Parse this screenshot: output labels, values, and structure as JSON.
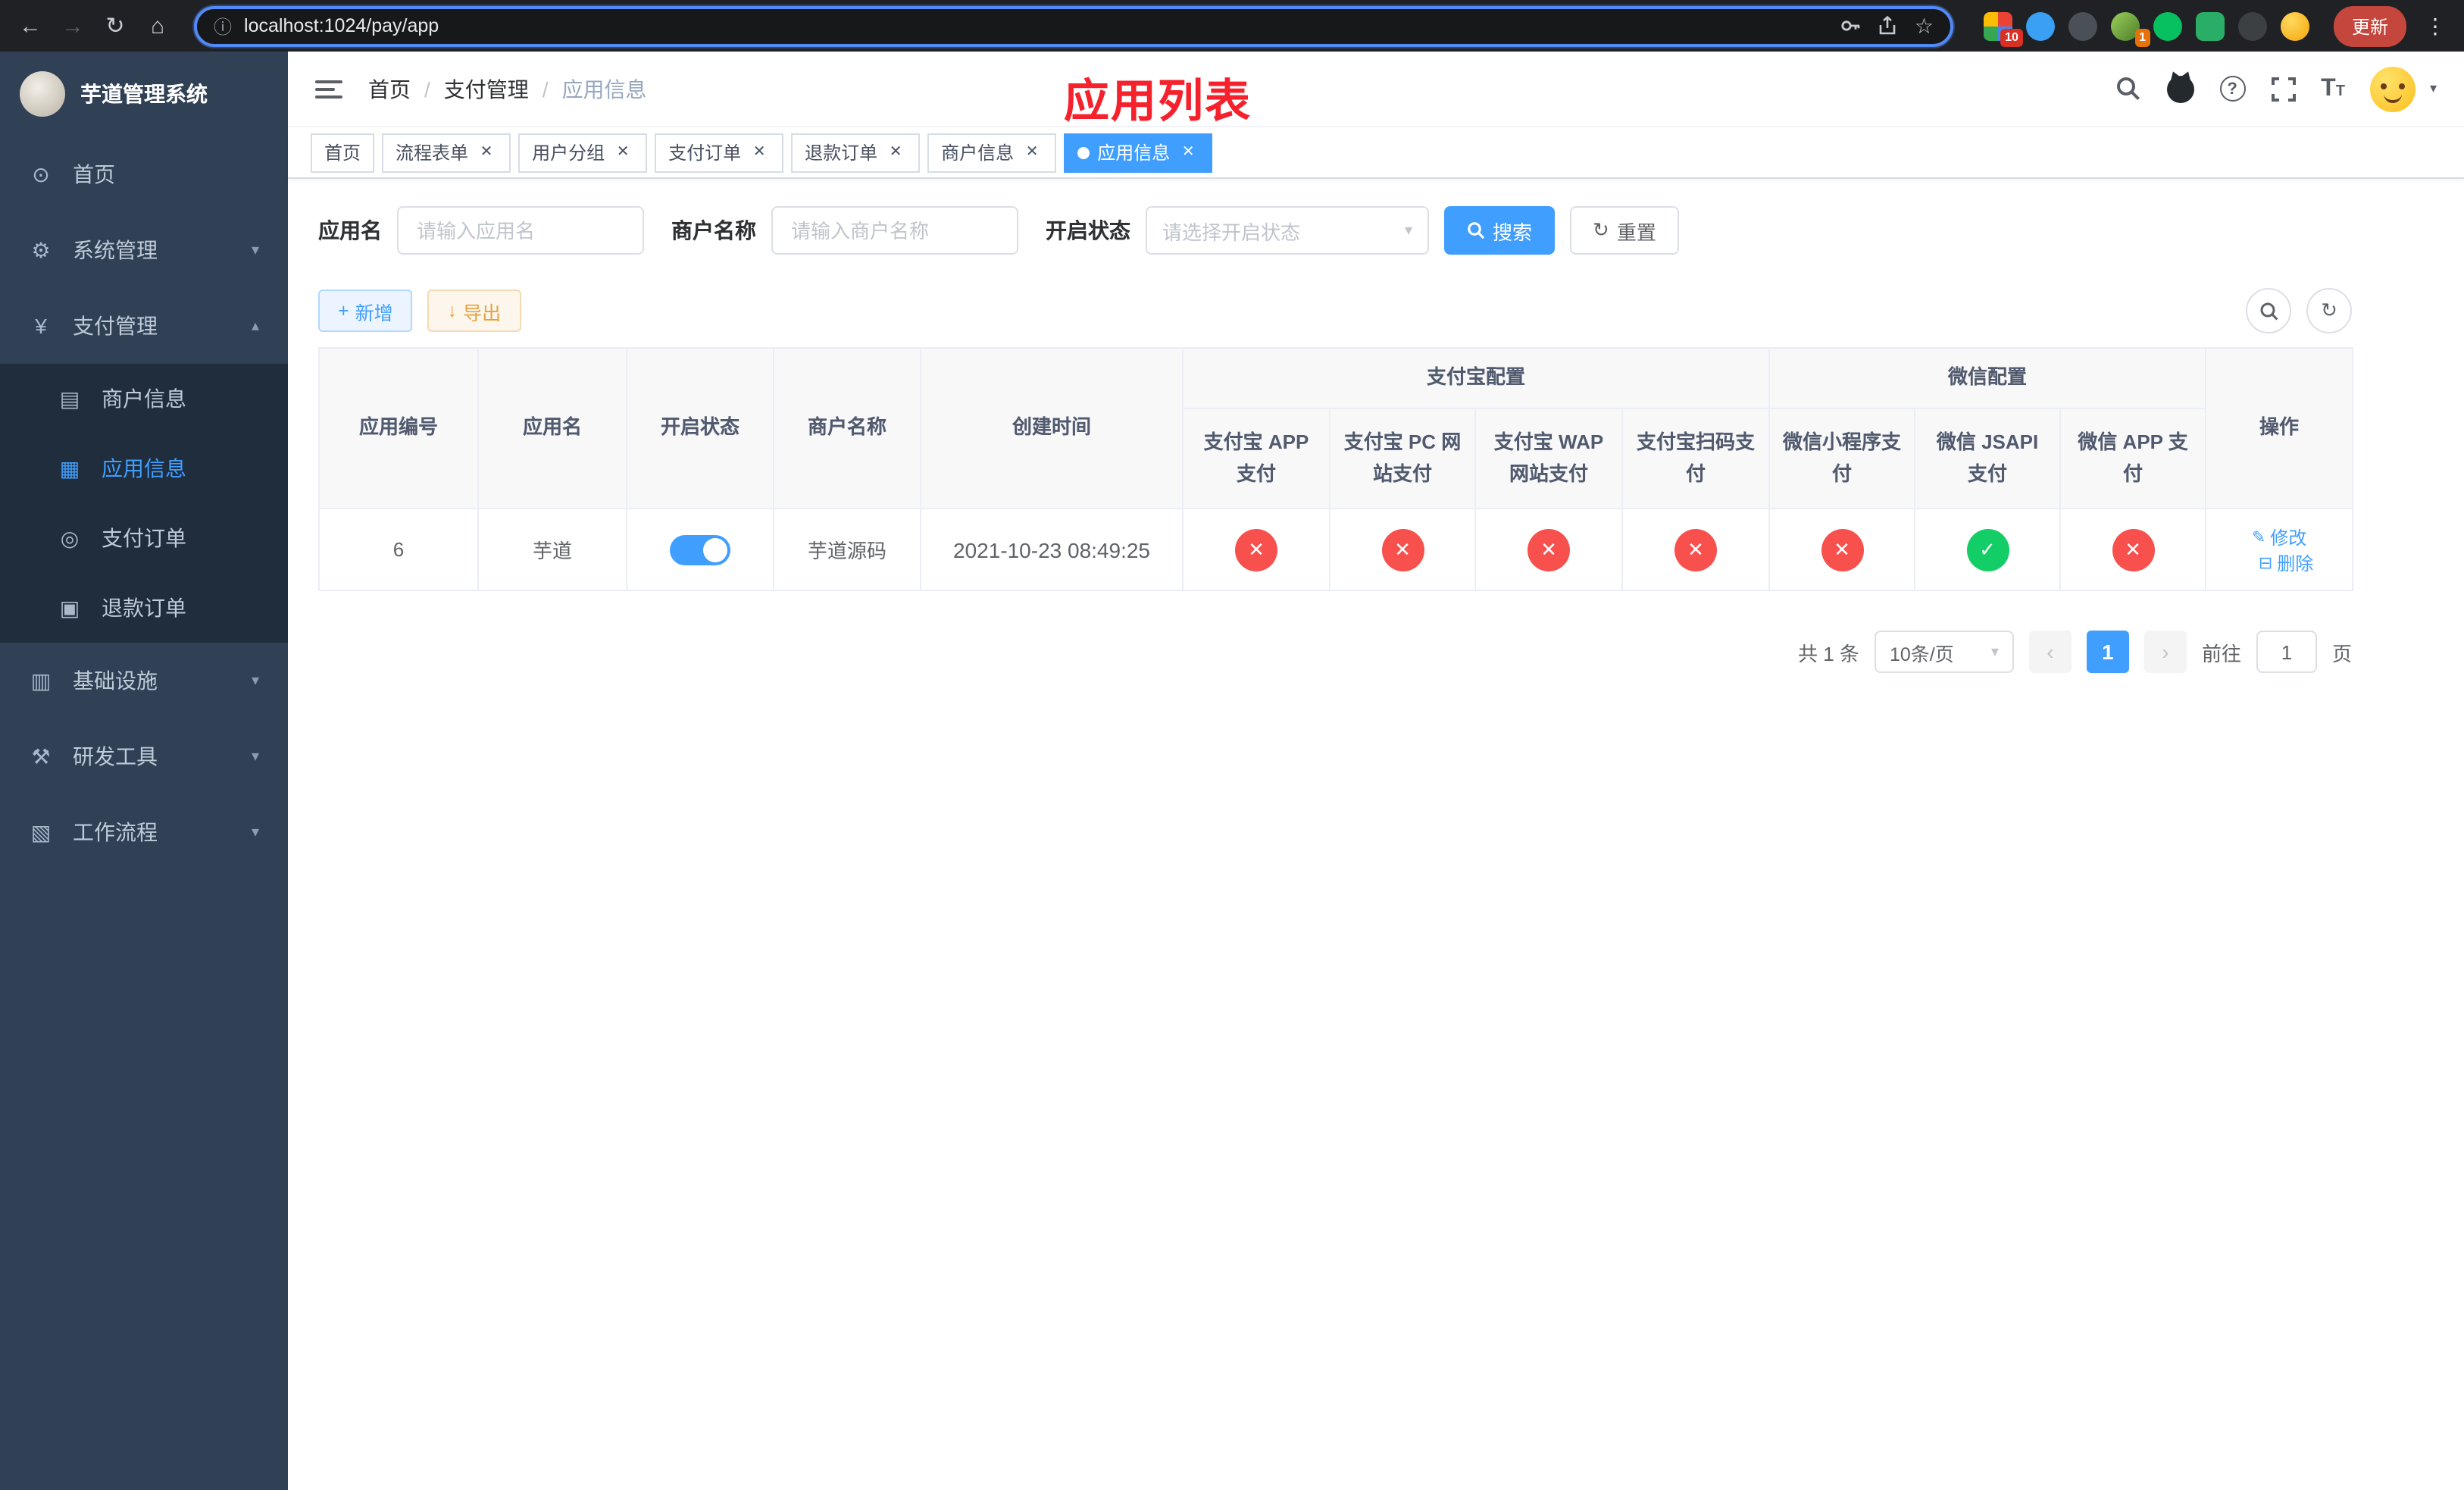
{
  "colors": {
    "accent": "#409eff",
    "danger": "#f7504d",
    "success": "#13ce66",
    "title_red": "#f5222d"
  },
  "icons": {
    "back": "←",
    "forward": "→",
    "reload": "↻",
    "home": "⌂",
    "info": "ⓘ",
    "star": "☆",
    "dots": "⋮",
    "dashboard": "⊙",
    "gear": "⚙",
    "yen": "¥",
    "merchant": "▤",
    "app": "▦",
    "order": "◎",
    "refund": "▣",
    "infra": "▥",
    "tools": "⚒",
    "workflow": "▧",
    "chevron_down": "▾",
    "chevron_up": "▴",
    "caret_down": "▾",
    "close": "✕",
    "check": "✓",
    "cross": "✕",
    "plus": "+",
    "download": "↓",
    "reset": "↻",
    "refresh": "↻",
    "edit": "✎",
    "trash": "⊟",
    "prev": "‹",
    "next": "›",
    "question": "?",
    "size_big": "T",
    "size_small": "T"
  },
  "browser": {
    "url": "localhost:1024/pay/app",
    "update_label": "更新",
    "ext_badge_grid": "10",
    "ext_badge_avatar": "1"
  },
  "sidebar": {
    "title": "芋道管理系统",
    "items": [
      {
        "label": "首页"
      },
      {
        "label": "系统管理"
      },
      {
        "label": "支付管理"
      },
      {
        "label": "基础设施"
      },
      {
        "label": "研发工具"
      },
      {
        "label": "工作流程"
      }
    ],
    "payment_children": [
      {
        "label": "商户信息"
      },
      {
        "label": "应用信息"
      },
      {
        "label": "支付订单"
      },
      {
        "label": "退款订单"
      }
    ]
  },
  "header": {
    "breadcrumb": [
      "首页",
      "支付管理",
      "应用信息"
    ],
    "title": "应用列表"
  },
  "tabs": [
    {
      "label": "首页"
    },
    {
      "label": "流程表单"
    },
    {
      "label": "用户分组"
    },
    {
      "label": "支付订单"
    },
    {
      "label": "退款订单"
    },
    {
      "label": "商户信息"
    },
    {
      "label": "应用信息"
    }
  ],
  "filters": {
    "app_name_label": "应用名",
    "app_name_placeholder": "请输入应用名",
    "merchant_label": "商户名称",
    "merchant_placeholder": "请输入商户名称",
    "status_label": "开启状态",
    "status_placeholder": "请选择开启状态",
    "search_label": "搜索",
    "reset_label": "重置"
  },
  "toolbar": {
    "add_label": "新增",
    "export_label": "导出"
  },
  "table": {
    "col_app_id": "应用编号",
    "col_app_name": "应用名",
    "col_status": "开启状态",
    "col_merchant": "商户名称",
    "col_created": "创建时间",
    "group_alipay": "支付宝配置",
    "group_wechat": "微信配置",
    "col_alipay_app": "支付宝 APP 支付",
    "col_alipay_pc": "支付宝 PC 网站支付",
    "col_alipay_wap": "支付宝 WAP 网站支付",
    "col_alipay_qr": "支付宝扫码支付",
    "col_wx_lite": "微信小程序支付",
    "col_wx_jsapi": "微信 JSAPI 支付",
    "col_wx_app": "微信 APP 支付",
    "col_actions": "操作",
    "rows": [
      {
        "id": "6",
        "name": "芋道",
        "status_on": true,
        "merchant": "芋道源码",
        "created": "2021-10-23 08:49:25",
        "alipay_app": false,
        "alipay_pc": false,
        "alipay_wap": false,
        "alipay_qr": false,
        "wx_lite": false,
        "wx_jsapi": true,
        "wx_app": false,
        "edit_label": "修改",
        "delete_label": "删除"
      }
    ]
  },
  "pagination": {
    "total": "共 1 条",
    "page_size": "10条/页",
    "current_page": "1",
    "goto_label": "前往",
    "goto_value": "1",
    "page_unit": "页"
  }
}
